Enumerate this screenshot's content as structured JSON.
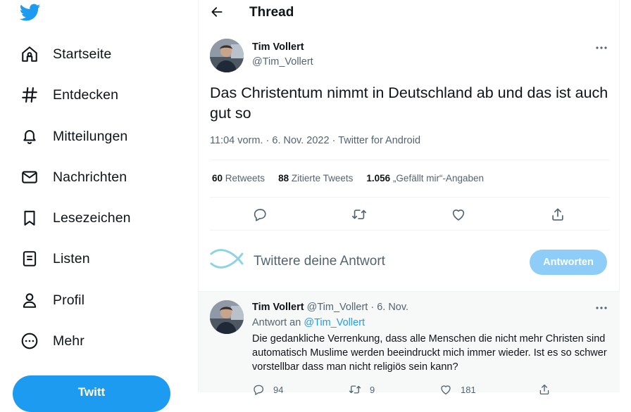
{
  "sidebar": {
    "logo_icon": "twitter-bird-icon",
    "items": [
      {
        "label": "Startseite",
        "icon": "home-icon"
      },
      {
        "label": "Entdecken",
        "icon": "hashtag-icon"
      },
      {
        "label": "Mitteilungen",
        "icon": "bell-icon"
      },
      {
        "label": "Nachrichten",
        "icon": "mail-icon"
      },
      {
        "label": "Lesezeichen",
        "icon": "bookmark-icon"
      },
      {
        "label": "Listen",
        "icon": "list-icon"
      },
      {
        "label": "Profil",
        "icon": "profile-icon"
      },
      {
        "label": "Mehr",
        "icon": "more-circle-icon"
      }
    ],
    "tweet_button": "Twitt"
  },
  "header": {
    "title": "Thread"
  },
  "tweet": {
    "author_name": "Tim Vollert",
    "author_handle": "@Tim_Vollert",
    "text": "Das Christentum nimmt in Deutschland ab und das ist auch gut so",
    "time": "11:04 vorm.",
    "sep1": " · ",
    "date": "6. Nov. 2022",
    "sep2": " · ",
    "source": "Twitter for Android",
    "stats": {
      "retweets_count": "60",
      "retweets_label": " Retweets",
      "quotes_count": "88",
      "quotes_label": " Zitierte Tweets",
      "likes_count": "1.056",
      "likes_label": " „Gefällt mir“-Angaben"
    }
  },
  "reply_box": {
    "placeholder": "Twittere deine Antwort",
    "button": "Antworten"
  },
  "reply": {
    "author_name": "Tim Vollert",
    "author_handle": "@Tim_Vollert",
    "dot": " · ",
    "date": "6. Nov.",
    "reply_to_label": "Antwort an ",
    "reply_to_handle": "@Tim_Vollert",
    "text": "Die gedankliche Verrenkung, dass alle Menschen die nicht mehr Christen sind automatisch Muslime werden beeindruckt mich immer wieder. Ist es so schwer vorstellbar dass man nicht religiös sein kann?",
    "replies": "94",
    "retweets": "9",
    "likes": "181"
  },
  "colors": {
    "accent": "#1d9bf0",
    "accent_disabled": "#8ecdf8",
    "muted_text": "#536471",
    "divider": "#eff3f4"
  }
}
